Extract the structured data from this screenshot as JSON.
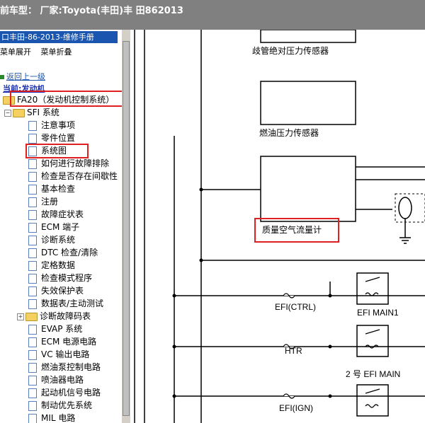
{
  "title": "前车型：  厂家:Toyota(丰田)丰 田862013",
  "sidebar": {
    "header": "口丰田-86-2013-维修手册",
    "expand_menu": "菜单展开",
    "collapse_menu": "菜单折叠",
    "back_link": "返回上一级",
    "current": "当前:发动机",
    "items": [
      {
        "label": "FA20（发动机控制系统）"
      },
      {
        "label": "SFI 系统"
      },
      {
        "label": "注意事项"
      },
      {
        "label": "零件位置"
      },
      {
        "label": "系统图"
      },
      {
        "label": "如何进行故障排除"
      },
      {
        "label": "检查是否存在间歇性"
      },
      {
        "label": "基本检查"
      },
      {
        "label": "注册"
      },
      {
        "label": "故障症状表"
      },
      {
        "label": "ECM 端子"
      },
      {
        "label": "诊断系统"
      },
      {
        "label": "DTC 检查/清除"
      },
      {
        "label": "定格数据"
      },
      {
        "label": "检查模式程序"
      },
      {
        "label": "失效保护表"
      },
      {
        "label": "数据表/主动测试"
      },
      {
        "label": "诊断故障码表"
      },
      {
        "label": "EVAP 系统"
      },
      {
        "label": "ECM 电源电路"
      },
      {
        "label": "VC 输出电路"
      },
      {
        "label": "燃油泵控制电路"
      },
      {
        "label": "喷油器电路"
      },
      {
        "label": "起动机信号电路"
      },
      {
        "label": "制动优先系统"
      },
      {
        "label": "MIL 电路"
      }
    ]
  },
  "diagram": {
    "sensor1": "歧管绝对压力传感器",
    "sensor2": "燃油压力传感器",
    "sensor3": "质量空气流量计",
    "fuse1": "EFI(CTRL)",
    "relay1": "EFI MAIN1",
    "fuse2": "HTR",
    "relay2": "2 号 EFI MAIN",
    "fuse3": "EFI(IGN)"
  }
}
